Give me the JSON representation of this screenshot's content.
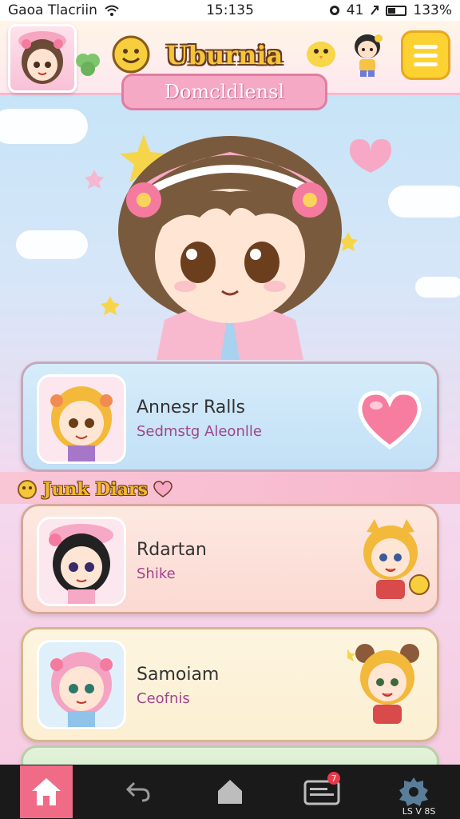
{
  "status_bar": {
    "carrier": "Gaoa Tlacriin",
    "time": "15:135",
    "battery_percent": "133%",
    "signal_text": "41"
  },
  "header": {
    "title": "Uburnia",
    "subtitle": "Domcldlensl"
  },
  "cards": [
    {
      "name": "Annesr Ralls",
      "subtitle": "Sedmstg Aleonlle"
    },
    {
      "name": "Rdartan",
      "subtitle": "Shike"
    },
    {
      "name": "Samoiam",
      "subtitle": "Ceofnis"
    }
  ],
  "section": {
    "label": "Junk Diars"
  },
  "bottom_nav": {
    "items": [
      {
        "icon": "home-icon",
        "active": true
      },
      {
        "icon": "back-arrow-icon",
        "active": false
      },
      {
        "icon": "house-icon",
        "active": false
      },
      {
        "icon": "inbox-icon",
        "active": false,
        "badge": "7"
      },
      {
        "icon": "settings-gear-icon",
        "active": false
      }
    ],
    "corner_text": "LS V 8S"
  },
  "colors": {
    "accent_pink": "#f06b86",
    "title_yellow": "#f3c53a",
    "heart_pink": "#f77da0",
    "menu_yellow": "#fbd232"
  }
}
